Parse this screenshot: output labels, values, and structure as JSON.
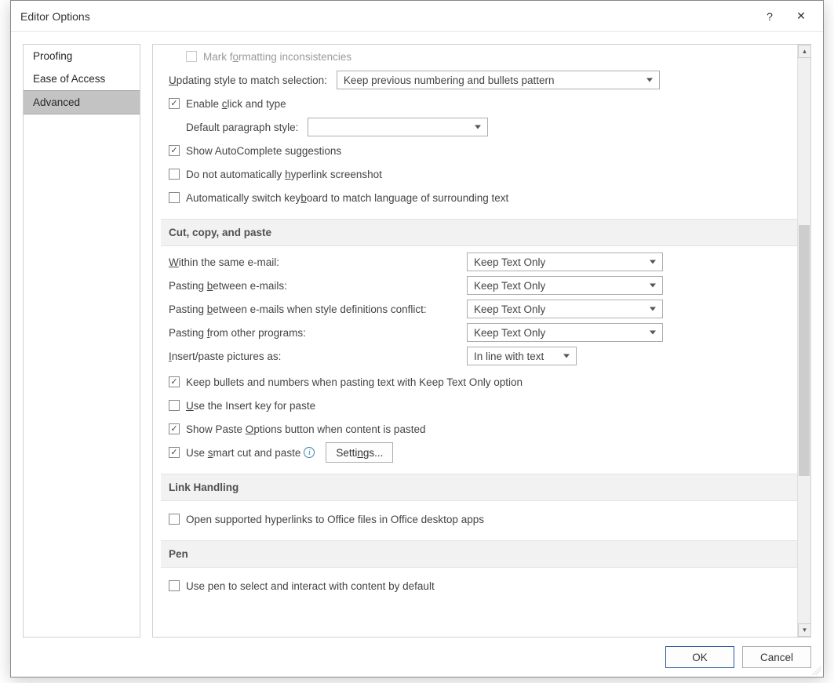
{
  "dialog": {
    "title": "Editor Options",
    "help_tooltip": "?",
    "close_tooltip": "✕"
  },
  "sidebar": {
    "items": [
      {
        "label": "Proofing",
        "selected": false
      },
      {
        "label": "Ease of Access",
        "selected": false
      },
      {
        "label": "Advanced",
        "selected": true
      }
    ]
  },
  "editing": {
    "mark_formatting_inconsistencies": {
      "label": "Mark formatting inconsistencies",
      "checked": false,
      "disabled": true
    },
    "updating_style_label": "Updating style to match selection:",
    "updating_style_value": "Keep previous numbering and bullets pattern",
    "enable_click_and_type": {
      "label": "Enable click and type",
      "checked": true
    },
    "default_paragraph_style_label": "Default paragraph style:",
    "default_paragraph_style_value": "",
    "show_autocomplete": {
      "label": "Show AutoComplete suggestions",
      "checked": true
    },
    "no_auto_hyperlink_screenshot": {
      "label": "Do not automatically hyperlink screenshot",
      "checked": false
    },
    "auto_switch_keyboard": {
      "label": "Automatically switch keyboard to match language of surrounding text",
      "checked": false
    }
  },
  "sections": {
    "cut_copy_paste": "Cut, copy, and paste",
    "link_handling": "Link Handling",
    "pen": "Pen"
  },
  "paste": {
    "within_same_label": "Within the same e-mail:",
    "within_same_value": "Keep Text Only",
    "between_label": "Pasting between e-mails:",
    "between_value": "Keep Text Only",
    "between_conflict_label": "Pasting between e-mails when style definitions conflict:",
    "between_conflict_value": "Keep Text Only",
    "from_other_label": "Pasting from other programs:",
    "from_other_value": "Keep Text Only",
    "insert_pictures_label": "Insert/paste pictures as:",
    "insert_pictures_value": "In line with text",
    "keep_bullets": {
      "label": "Keep bullets and numbers when pasting text with Keep Text Only option",
      "checked": true
    },
    "use_insert_key": {
      "label": "Use the Insert key for paste",
      "checked": false
    },
    "show_paste_options": {
      "label": "Show Paste Options button when content is pasted",
      "checked": true
    },
    "smart_cut_paste": {
      "label": "Use smart cut and paste",
      "checked": true
    },
    "settings_button": "Settings..."
  },
  "link_handling": {
    "open_hyperlinks_desktop": {
      "label": "Open supported hyperlinks to Office files in Office desktop apps",
      "checked": false
    }
  },
  "pen": {
    "use_pen_select": {
      "label": "Use pen to select and interact with content by default",
      "checked": false
    }
  },
  "footer": {
    "ok": "OK",
    "cancel": "Cancel"
  }
}
